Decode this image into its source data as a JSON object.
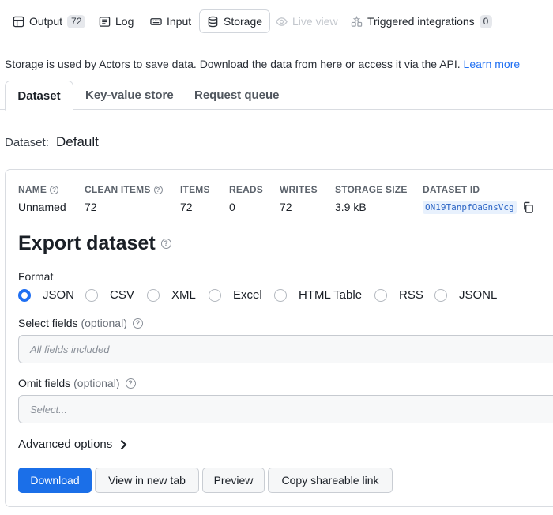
{
  "top_tabs": [
    {
      "label": "Output",
      "badge": "72",
      "icon": "table-icon"
    },
    {
      "label": "Log",
      "icon": "log-icon"
    },
    {
      "label": "Input",
      "icon": "keyboard-icon"
    },
    {
      "label": "Storage",
      "icon": "database-icon",
      "active": true
    },
    {
      "label": "Live view",
      "icon": "eye-icon",
      "disabled": true
    },
    {
      "label": "Triggered integrations",
      "badge": "0",
      "icon": "integrations-icon"
    }
  ],
  "intro": {
    "text": "Storage is used by Actors to save data. Download the data from here or access it via the API. ",
    "link": "Learn more"
  },
  "storage_tabs": [
    "Dataset",
    "Key-value store",
    "Request queue"
  ],
  "dataset_selector": {
    "label": "Dataset:",
    "value": "Default"
  },
  "stats": {
    "headers": [
      "NAME",
      "CLEAN ITEMS",
      "ITEMS",
      "READS",
      "WRITES",
      "STORAGE SIZE",
      "DATASET ID"
    ],
    "values": [
      "Unnamed",
      "72",
      "72",
      "0",
      "72",
      "3.9 kB"
    ],
    "dataset_id": "ON19TanpfOaGnsVcg"
  },
  "export": {
    "title": "Export dataset",
    "format_label": "Format",
    "formats": [
      "JSON",
      "CSV",
      "XML",
      "Excel",
      "HTML Table",
      "RSS",
      "JSONL"
    ],
    "selected_format": "JSON",
    "select_fields_label": "Select fields",
    "select_fields_optional": "(optional)",
    "select_fields_placeholder": "All fields included",
    "omit_fields_label": "Omit fields",
    "omit_fields_optional": "(optional)",
    "omit_fields_placeholder": "Select...",
    "advanced_options": "Advanced options"
  },
  "buttons": {
    "download": "Download",
    "view_new_tab": "View in new tab",
    "preview": "Preview",
    "copy_link": "Copy shareable link"
  },
  "colors": {
    "accent": "#1f6ff2",
    "primary_button": "#1b6fe8",
    "dataset_id_bg": "#e8f1fd"
  }
}
